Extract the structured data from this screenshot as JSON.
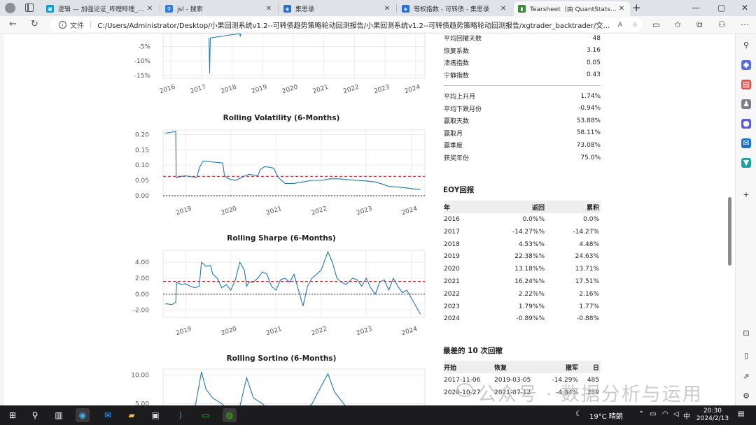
{
  "browser": {
    "tabs": [
      {
        "title": "逻辑 — 加强论证_哔哩哔哩_bilib",
        "color": "#00a1d6",
        "glyph": "▣"
      },
      {
        "title": "jsl - 搜索",
        "color": "#2f7de1",
        "glyph": "⚲"
      },
      {
        "title": "集思录",
        "color": "#2a6fd6",
        "glyph": "◈"
      },
      {
        "title": "等权指数 - 可转债 - 集思录",
        "color": "#2a6fd6",
        "glyph": "◈"
      },
      {
        "title": "Tearsheet（由 QuantStats 生成）",
        "color": "#3a8b3a",
        "glyph": "▮",
        "active": true
      }
    ],
    "address": {
      "file_label": "文件",
      "url": "C:/Users/Administrator/Desktop/小果回测系统v1.2--可转债趋势策略轮动回测报告/小果回测系统v1.2--可转债趋势策略轮动回测报告/xgtrader_backtrader/交易..."
    }
  },
  "charts": [
    {
      "id": "drawdown-partial",
      "title": "",
      "type": "line",
      "x_ticks": [
        "2016",
        "2017",
        "2018",
        "2019",
        "2020",
        "2021",
        "2022",
        "2023",
        "2024"
      ],
      "y_ticks": [
        "-5%",
        "-10%",
        "-15%"
      ],
      "series": [
        {
          "points": [
            [
              2017.25,
              -2
            ],
            [
              2017.27,
              -14.3
            ],
            [
              2017.29,
              -2
            ],
            [
              2018.25,
              -0.5
            ],
            [
              2018.27,
              -1.5
            ],
            [
              2018.29,
              -0.5
            ]
          ]
        }
      ]
    },
    {
      "id": "rolling-volatility",
      "title": "Rolling Volatility (6-Months)",
      "type": "line",
      "x_ticks": [
        "2019",
        "2020",
        "2021",
        "2022",
        "2023",
        "2024"
      ],
      "y_ticks": [
        "0.20",
        "0.15",
        "0.10",
        "0.05",
        "0.00"
      ],
      "mean_line": 0.063,
      "zero_line": 0.0,
      "ylim": [
        -0.005,
        0.215
      ]
    },
    {
      "id": "rolling-sharpe",
      "title": "Rolling Sharpe (6-Months)",
      "type": "line",
      "x_ticks": [
        "2019",
        "2020",
        "2021",
        "2022",
        "2023",
        "2024"
      ],
      "y_ticks": [
        "4.00",
        "2.00",
        "0.00",
        "-2.00"
      ],
      "mean_line": 1.6,
      "zero_line": 0.0,
      "ylim": [
        -2.9,
        5.5
      ]
    },
    {
      "id": "rolling-sortino",
      "title": "Rolling Sortino (6-Months)",
      "type": "line",
      "x_ticks": [],
      "y_ticks": [
        "10.00",
        "5.00"
      ],
      "ylim": [
        3,
        11
      ]
    }
  ],
  "chart_data": [
    {
      "type": "line",
      "title": "",
      "xlabel": "",
      "ylabel": "",
      "x_ticks": [
        "2016",
        "2017",
        "2018",
        "2019",
        "2020",
        "2021",
        "2022",
        "2023",
        "2024"
      ],
      "y_ticks": [
        "-5%",
        "-10%",
        "-15%"
      ],
      "series": [
        {
          "x": [
            2017.25,
            2017.27,
            2017.29,
            2018.25,
            2018.27,
            2018.29
          ],
          "y": [
            -2,
            -14.3,
            -2,
            -0.5,
            -1.5,
            -0.5
          ]
        }
      ]
    },
    {
      "type": "line",
      "title": "Rolling Volatility (6-Months)",
      "xlabel": "",
      "ylabel": "",
      "xlim": [
        2018.5,
        2024.3
      ],
      "ylim": [
        -0.005,
        0.215
      ],
      "x_ticks": [
        "2019",
        "2020",
        "2021",
        "2022",
        "2023",
        "2024"
      ],
      "y_ticks": [
        "0.20",
        "0.15",
        "0.10",
        "0.05",
        "0.00"
      ],
      "series": [
        {
          "x": [
            2018.55,
            2018.65,
            2018.75,
            2018.78,
            2018.79,
            2018.9,
            2019.0,
            2019.1,
            2019.25,
            2019.3,
            2019.38,
            2019.45,
            2019.6,
            2019.82,
            2019.86,
            2019.95,
            2020.1,
            2020.25,
            2020.4,
            2020.6,
            2020.65,
            2020.75,
            2020.85,
            2020.95,
            2021.0,
            2021.05,
            2021.2,
            2021.4,
            2021.6,
            2021.8,
            2022.0,
            2022.2,
            2022.4,
            2022.6,
            2022.8,
            2023.0,
            2023.2,
            2023.35,
            2023.5,
            2023.7,
            2023.9,
            2024.05,
            2024.2
          ],
          "y": [
            0.205,
            0.207,
            0.21,
            0.21,
            0.058,
            0.063,
            0.065,
            0.062,
            0.06,
            0.09,
            0.112,
            0.113,
            0.11,
            0.107,
            0.065,
            0.055,
            0.05,
            0.06,
            0.07,
            0.065,
            0.085,
            0.095,
            0.093,
            0.09,
            0.075,
            0.06,
            0.04,
            0.04,
            0.045,
            0.05,
            0.05,
            0.055,
            0.055,
            0.052,
            0.05,
            0.048,
            0.045,
            0.038,
            0.03,
            0.028,
            0.025,
            0.022,
            0.02
          ]
        }
      ],
      "mean_line": 0.063,
      "zero_line": 0.0
    },
    {
      "type": "line",
      "title": "Rolling Sharpe (6-Months)",
      "xlabel": "",
      "ylabel": "",
      "xlim": [
        2018.5,
        2024.3
      ],
      "ylim": [
        -2.9,
        5.5
      ],
      "x_ticks": [
        "2019",
        "2020",
        "2021",
        "2022",
        "2023",
        "2024"
      ],
      "y_ticks": [
        "4.00",
        "2.00",
        "0.00",
        "-2.00"
      ],
      "series": [
        {
          "x": [
            2018.55,
            2018.7,
            2018.78,
            2018.8,
            2018.9,
            2019.0,
            2019.1,
            2019.2,
            2019.3,
            2019.35,
            2019.45,
            2019.55,
            2019.6,
            2019.7,
            2019.8,
            2019.9,
            2020.0,
            2020.1,
            2020.2,
            2020.3,
            2020.35,
            2020.4,
            2020.5,
            2020.6,
            2020.7,
            2020.8,
            2020.9,
            2021.0,
            2021.1,
            2021.2,
            2021.3,
            2021.4,
            2021.5,
            2021.6,
            2021.7,
            2021.8,
            2021.9,
            2022.0,
            2022.1,
            2022.15,
            2022.25,
            2022.35,
            2022.45,
            2022.55,
            2022.7,
            2022.8,
            2022.9,
            2023.0,
            2023.1,
            2023.2,
            2023.3,
            2023.4,
            2023.5,
            2023.6,
            2023.7,
            2023.8,
            2023.9,
            2024.0,
            2024.1,
            2024.2
          ],
          "y": [
            -1.2,
            -1.3,
            -1.0,
            1.5,
            1.2,
            1.3,
            1.0,
            0.8,
            1.0,
            4.0,
            3.5,
            3.6,
            2.5,
            2.0,
            0.8,
            1.2,
            0.5,
            1.8,
            4.0,
            3.0,
            1.0,
            1.5,
            1.5,
            2.0,
            2.8,
            2.5,
            1.0,
            0.5,
            1.8,
            2.0,
            1.5,
            2.5,
            0.5,
            -1.5,
            1.0,
            2.0,
            2.5,
            3.0,
            4.5,
            5.3,
            4.0,
            2.0,
            1.5,
            1.2,
            2.0,
            1.8,
            1.0,
            2.0,
            0.8,
            0.0,
            1.5,
            1.8,
            0.5,
            2.0,
            1.0,
            0.2,
            0.5,
            -0.5,
            -1.5,
            -2.5
          ]
        }
      ],
      "mean_line": 1.6,
      "zero_line": 0.0
    },
    {
      "type": "line",
      "title": "Rolling Sortino (6-Months)",
      "xlabel": "",
      "ylabel": "",
      "xlim": [
        2018.5,
        2024.3
      ],
      "ylim": [
        3,
        11
      ],
      "y_ticks": [
        "10.00",
        "5.00"
      ],
      "series": [
        {
          "x": [
            2018.55,
            2018.7,
            2018.8,
            2019.0,
            2019.2,
            2019.35,
            2019.45,
            2019.6,
            2019.8,
            2020.0,
            2020.2,
            2020.35,
            2020.5,
            2020.7,
            2020.9,
            2021.0,
            2021.2,
            2021.4,
            2021.6,
            2021.8,
            2022.0,
            2022.15,
            2022.3,
            2022.45,
            2022.6,
            2022.8,
            2023.0
          ],
          "y": [
            3.5,
            3.2,
            3.0,
            3.5,
            4.0,
            10.5,
            7.5,
            6.0,
            5.0,
            3.5,
            4.5,
            9.5,
            6.0,
            5.0,
            3.5,
            4.0,
            3.0,
            4.0,
            3.5,
            5.0,
            8.0,
            10.2,
            7.0,
            5.5,
            4.0,
            3.0,
            3.0
          ]
        }
      ]
    }
  ],
  "metrics_top": [
    {
      "label": "平均回撤天数",
      "value": "48"
    },
    {
      "label": "恢复系数",
      "value": "3.16"
    },
    {
      "label": "溃疡指数",
      "value": "0.05"
    },
    {
      "label": "宁静指数",
      "value": "0.43"
    }
  ],
  "metrics_mid": [
    {
      "label": "平均上升月",
      "value": "1.74%"
    },
    {
      "label": "平均下跌月份",
      "value": "-0.94%"
    },
    {
      "label": "赢取天数",
      "value": "53.88%"
    },
    {
      "label": "赢取月",
      "value": "58.11%"
    },
    {
      "label": "赢季度",
      "value": "73.08%"
    },
    {
      "label": "获奖年份",
      "value": "75.0%"
    }
  ],
  "eoy": {
    "title": "EOY回报",
    "headers": [
      "年",
      "返回",
      "累积"
    ],
    "rows": [
      [
        "2016",
        "0.0%%",
        "0.0%"
      ],
      [
        "2017",
        "-14.27%%",
        "-14.27%"
      ],
      [
        "2018",
        "4.53%%",
        "4.48%"
      ],
      [
        "2019",
        "22.38%%",
        "24.63%"
      ],
      [
        "2020",
        "13.18%%",
        "13.71%"
      ],
      [
        "2021",
        "16.24%%",
        "17.51%"
      ],
      [
        "2022",
        "2.22%%",
        "2.16%"
      ],
      [
        "2023",
        "1.79%%",
        "1.77%"
      ],
      [
        "2024",
        "-0.89%%",
        "-0.88%"
      ]
    ]
  },
  "worst_drawdowns": {
    "title": "最差的 10 次回撤",
    "headers": [
      "开始",
      "恢复",
      "撤军",
      "日"
    ],
    "rows": [
      [
        "2017-11-06",
        "2019-03-05",
        "-14.29%",
        "485"
      ],
      [
        "2020-10-27",
        "2021-07-12",
        "-4.84%",
        "259"
      ]
    ]
  },
  "watermark": "公众号 · 数据分析与运用",
  "taskbar": {
    "weather": "19°C 晴朗",
    "ime": "中",
    "time": "20:30",
    "date": "2024/2/13"
  }
}
